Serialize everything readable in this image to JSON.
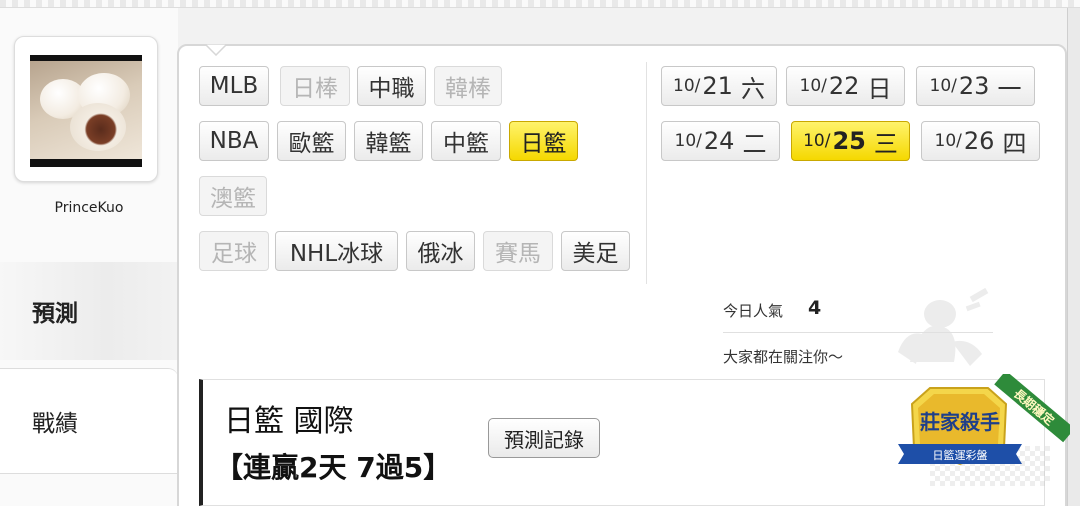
{
  "user": {
    "name": "PrinceKuo"
  },
  "nav": {
    "tabs": [
      {
        "label": "預測"
      },
      {
        "label": "戰績"
      }
    ]
  },
  "sports": [
    {
      "label": "MLB",
      "state": "normal"
    },
    {
      "label": "日棒",
      "state": "disabled"
    },
    {
      "label": "中職",
      "state": "normal"
    },
    {
      "label": "韓棒",
      "state": "disabled"
    },
    {
      "label": "NBA",
      "state": "normal"
    },
    {
      "label": "歐籃",
      "state": "normal"
    },
    {
      "label": "韓籃",
      "state": "normal"
    },
    {
      "label": "中籃",
      "state": "normal"
    },
    {
      "label": "日籃",
      "state": "active"
    },
    {
      "label": "澳籃",
      "state": "disabled"
    },
    {
      "label": "足球",
      "state": "disabled"
    },
    {
      "label": "NHL冰球",
      "state": "normal"
    },
    {
      "label": "俄冰",
      "state": "normal"
    },
    {
      "label": "賽馬",
      "state": "disabled"
    },
    {
      "label": "美足",
      "state": "normal"
    }
  ],
  "dates": [
    {
      "month": "10/",
      "day": "21",
      "weekday": "六",
      "state": "normal"
    },
    {
      "month": "10/",
      "day": "22",
      "weekday": "日",
      "state": "normal"
    },
    {
      "month": "10/",
      "day": "23",
      "weekday": "一",
      "state": "normal"
    },
    {
      "month": "10/",
      "day": "24",
      "weekday": "二",
      "state": "normal"
    },
    {
      "month": "10/",
      "day": "25",
      "weekday": "三",
      "state": "active"
    },
    {
      "month": "10/",
      "day": "26",
      "weekday": "四",
      "state": "normal"
    }
  ],
  "popularity": {
    "label": "今日人氣",
    "value": "4",
    "follow_text": "大家都在關注你～"
  },
  "prediction": {
    "title": "日籃 國際",
    "streak": "【連贏2天 7過5】",
    "record_button": "預測記錄"
  },
  "badge": {
    "title": "莊家殺手",
    "subtitle": "日籃運彩盤",
    "ribbon": "長期穩定"
  },
  "colors": {
    "active_yellow": "#f5d800",
    "badge_blue": "#1e4fa8",
    "ribbon_green": "#2e8b3a"
  }
}
